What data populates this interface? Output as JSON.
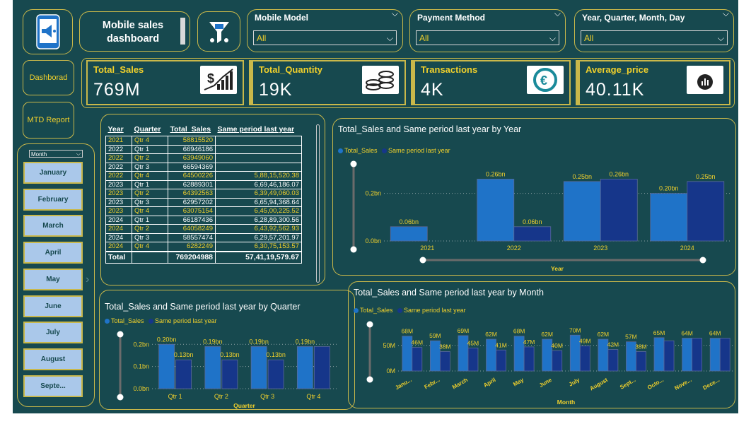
{
  "header": {
    "title_line1": "Mobile sales",
    "title_line2": "dashboard",
    "slicers": [
      {
        "label": "Mobile Model",
        "value": "All"
      },
      {
        "label": "Payment Method",
        "value": "All"
      },
      {
        "label": "Year, Quarter, Month, Day",
        "value": "All"
      }
    ]
  },
  "nav": {
    "dashboard": "Dashborad",
    "mtd": "MTD Report"
  },
  "kpis": [
    {
      "title": "Total_Sales",
      "value": "769M"
    },
    {
      "title": "Total_Quantity",
      "value": "19K"
    },
    {
      "title": "Transactions",
      "value": "4K"
    },
    {
      "title": "Average_price",
      "value": "40.11K"
    }
  ],
  "month_slicer": {
    "label": "Month",
    "items": [
      "January",
      "February",
      "March",
      "April",
      "May",
      "June",
      "July",
      "August",
      "Septe..."
    ]
  },
  "table": {
    "headers": [
      "Year",
      "Quarter",
      "Total_Sales",
      "Same period last year"
    ],
    "rows": [
      [
        "2021",
        "Qtr 4",
        "58815520",
        ""
      ],
      [
        "2022",
        "Qtr 1",
        "66946186",
        ""
      ],
      [
        "2022",
        "Qtr 2",
        "63949060",
        ""
      ],
      [
        "2022",
        "Qtr 3",
        "66594369",
        ""
      ],
      [
        "2022",
        "Qtr 4",
        "64500226",
        "5,88,15,520.38"
      ],
      [
        "2023",
        "Qtr 1",
        "62889301",
        "6,69,46,186.07"
      ],
      [
        "2023",
        "Qtr 2",
        "64392563",
        "6,39,49,060.03"
      ],
      [
        "2023",
        "Qtr 3",
        "62957202",
        "6,65,94,368.64"
      ],
      [
        "2023",
        "Qtr 4",
        "63075154",
        "6,45,00,225.52"
      ],
      [
        "2024",
        "Qtr 1",
        "66187436",
        "6,28,89,300.56"
      ],
      [
        "2024",
        "Qtr 2",
        "64058249",
        "6,43,92,562.93"
      ],
      [
        "2024",
        "Qtr 3",
        "58557474",
        "6,29,57,201.97"
      ],
      [
        "2024",
        "Qtr 4",
        "6282249",
        "6,30,75,153.57"
      ]
    ],
    "total": [
      "Total",
      "",
      "769204988",
      "57,41,19,579.67"
    ]
  },
  "colors": {
    "bg": "#17494f",
    "accent": "#f0d02c",
    "border": "#c9b84a",
    "series1": "#1f73c8",
    "series2": "#16368a"
  },
  "chart_data": [
    {
      "type": "bar",
      "title": "Total_Sales and Same period last year by Year",
      "xlabel": "Year",
      "legend": [
        "Total_Sales",
        "Same period last year"
      ],
      "categories": [
        "2021",
        "2022",
        "2023",
        "2024"
      ],
      "series": [
        {
          "name": "Total_Sales",
          "values": [
            0.06,
            0.26,
            0.25,
            0.2
          ],
          "labels": [
            "0.06bn",
            "0.26bn",
            "0.25bn",
            "0.20bn"
          ]
        },
        {
          "name": "Same period last year",
          "values": [
            null,
            0.06,
            0.26,
            0.25
          ],
          "labels": [
            "",
            "0.06bn",
            "0.26bn",
            "0.25bn"
          ]
        }
      ],
      "yticks": [
        "0.0bn",
        "0.2bn"
      ],
      "ylim": [
        0,
        0.3
      ]
    },
    {
      "type": "bar",
      "title": "Total_Sales and Same period last year by Quarter",
      "xlabel": "Quarter",
      "legend": [
        "Total_Sales",
        "Same period last year"
      ],
      "categories": [
        "Qtr 1",
        "Qtr 2",
        "Qtr 3",
        "Qtr 4"
      ],
      "series": [
        {
          "name": "Total_Sales",
          "values": [
            0.2,
            0.19,
            0.19,
            0.19
          ],
          "labels": [
            "0.20bn",
            "0.19bn",
            "0.19bn",
            "0.19bn"
          ]
        },
        {
          "name": "Same period last year",
          "values": [
            0.13,
            0.13,
            0.13,
            0.19
          ],
          "labels": [
            "0.13bn",
            "0.13bn",
            "0.13bn",
            ""
          ]
        }
      ],
      "yticks": [
        "0.0bn",
        "0.1bn",
        "0.2bn"
      ],
      "ylim": [
        0,
        0.22
      ]
    },
    {
      "type": "bar",
      "title": "Total_Sales and Same period last year by Month",
      "xlabel": "Month",
      "legend": [
        "Total_Sales",
        "Same period last year"
      ],
      "categories": [
        "Janu...",
        "Febr...",
        "March",
        "April",
        "May",
        "June",
        "July",
        "August",
        "Sept...",
        "Octo...",
        "Nove...",
        "Dece..."
      ],
      "series": [
        {
          "name": "Total_Sales",
          "values": [
            68,
            59,
            69,
            62,
            68,
            62,
            70,
            62,
            57,
            65,
            64,
            64
          ],
          "labels": [
            "68M",
            "59M",
            "69M",
            "62M",
            "68M",
            "62M",
            "70M",
            "62M",
            "57M",
            "65M",
            "64M",
            "64M"
          ]
        },
        {
          "name": "Same period last year",
          "values": [
            46,
            38,
            45,
            41,
            47,
            40,
            49,
            42,
            38,
            59,
            64,
            64
          ],
          "labels": [
            "46M",
            "38M",
            "45M",
            "41M",
            "47M",
            "40M",
            "49M",
            "42M",
            "38M",
            "",
            "",
            ""
          ]
        }
      ],
      "yticks": [
        "0M",
        "50M"
      ],
      "ylim": [
        0,
        80
      ]
    }
  ]
}
